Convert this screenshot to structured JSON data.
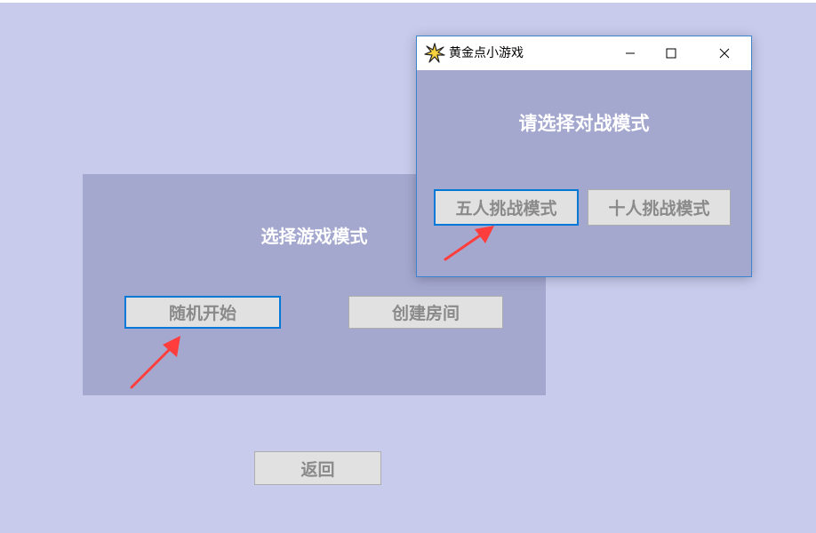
{
  "main_panel": {
    "title": "选择游戏模式",
    "random_start_label": "随机开始",
    "create_room_label": "创建房间"
  },
  "back_label": "返回",
  "dialog": {
    "window_title": "黄金点小游戏",
    "heading": "请选择对战模式",
    "five_player_label": "五人挑战模式",
    "ten_player_label": "十人挑战模式"
  },
  "colors": {
    "background": "#c8cbec",
    "panel": "#a4a8cf",
    "button": "#e1e1e1",
    "button_text": "#8a8a8a",
    "focus_border": "#0078d7",
    "arrow": "#ff3d3d"
  },
  "icons": {
    "app": "starburst-icon",
    "minimize": "minimize-icon",
    "maximize": "maximize-icon",
    "close": "close-icon",
    "annotation": "red-arrow-icon"
  }
}
